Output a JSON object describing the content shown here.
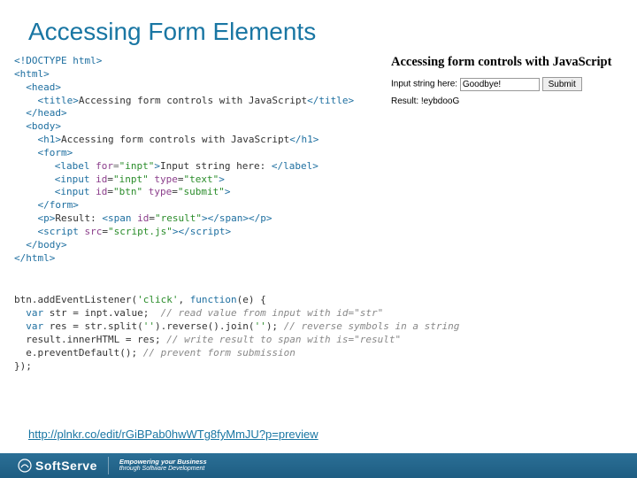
{
  "title": "Accessing Form Elements",
  "htmlcode": {
    "l1": "<!DOCTYPE html>",
    "l2": "<html>",
    "l3": "<head>",
    "l4a": "<title>",
    "l4b": "Accessing form controls with JavaScript",
    "l4c": "</title>",
    "l5": "</head>",
    "l6": "<body>",
    "l7a": "<h1>",
    "l7b": "Accessing form controls with JavaScript",
    "l7c": "</h1>",
    "l8": "<form>",
    "l9a": "<label",
    "l9attr": " for",
    "l9eq": "=",
    "l9v": "\"inpt\"",
    "l9b": ">",
    "l9t": "Input string here: ",
    "l9c": "</label>",
    "l10a": "<input",
    "l10attr1": " id",
    "l10v1": "\"inpt\"",
    "l10attr2": " type",
    "l10v2": "\"text\"",
    "l10b": ">",
    "l11a": "<input",
    "l11attr1": " id",
    "l11v1": "\"btn\"",
    "l11attr2": " type",
    "l11v2": "\"submit\"",
    "l11b": ">",
    "l12": "</form>",
    "l13a": "<p>",
    "l13t": "Result: ",
    "l13b": "<span",
    "l13attr": " id",
    "l13v": "\"result\"",
    "l13c": "></span></p>",
    "l14a": "<script",
    "l14attr": " src",
    "l14v": "\"script.js\"",
    "l14b": "></",
    "l14c": "script",
    "l14d": ">",
    "l15": "</body>",
    "l16": "</html>"
  },
  "jscode": {
    "l1a": "btn.addEventListener(",
    "l1s": "'click'",
    "l1b": ", ",
    "l1kw": "function",
    "l1c": "(e) {",
    "l2kw": "var",
    "l2a": " str = inpt.value;  ",
    "l2c": "// read value from input with id=\"str\"",
    "l3kw": "var",
    "l3a": " res = str.split(",
    "l3s1": "''",
    "l3b": ").reverse().join(",
    "l3s2": "''",
    "l3c": "); ",
    "l3cm": "// reverse symbols in a string",
    "l4a": "result.innerHTML = res; ",
    "l4c": "// write result to span with is=\"result\"",
    "l5a": "e.preventDefault(); ",
    "l5c": "// prevent form submission",
    "l6": "});"
  },
  "preview": {
    "heading": "Accessing form controls with JavaScript",
    "label": "Input string here:",
    "input_value": "Goodbye!",
    "submit_label": "Submit",
    "result_label": "Result: ",
    "result_value": "!eybdooG"
  },
  "link_text": "http://plnkr.co/edit/rGiBPab0hwWTg8fyMmJU?p=preview",
  "footer": {
    "brand": "SoftServe",
    "tag1": "Empowering your Business",
    "tag2": "through Software Development"
  }
}
